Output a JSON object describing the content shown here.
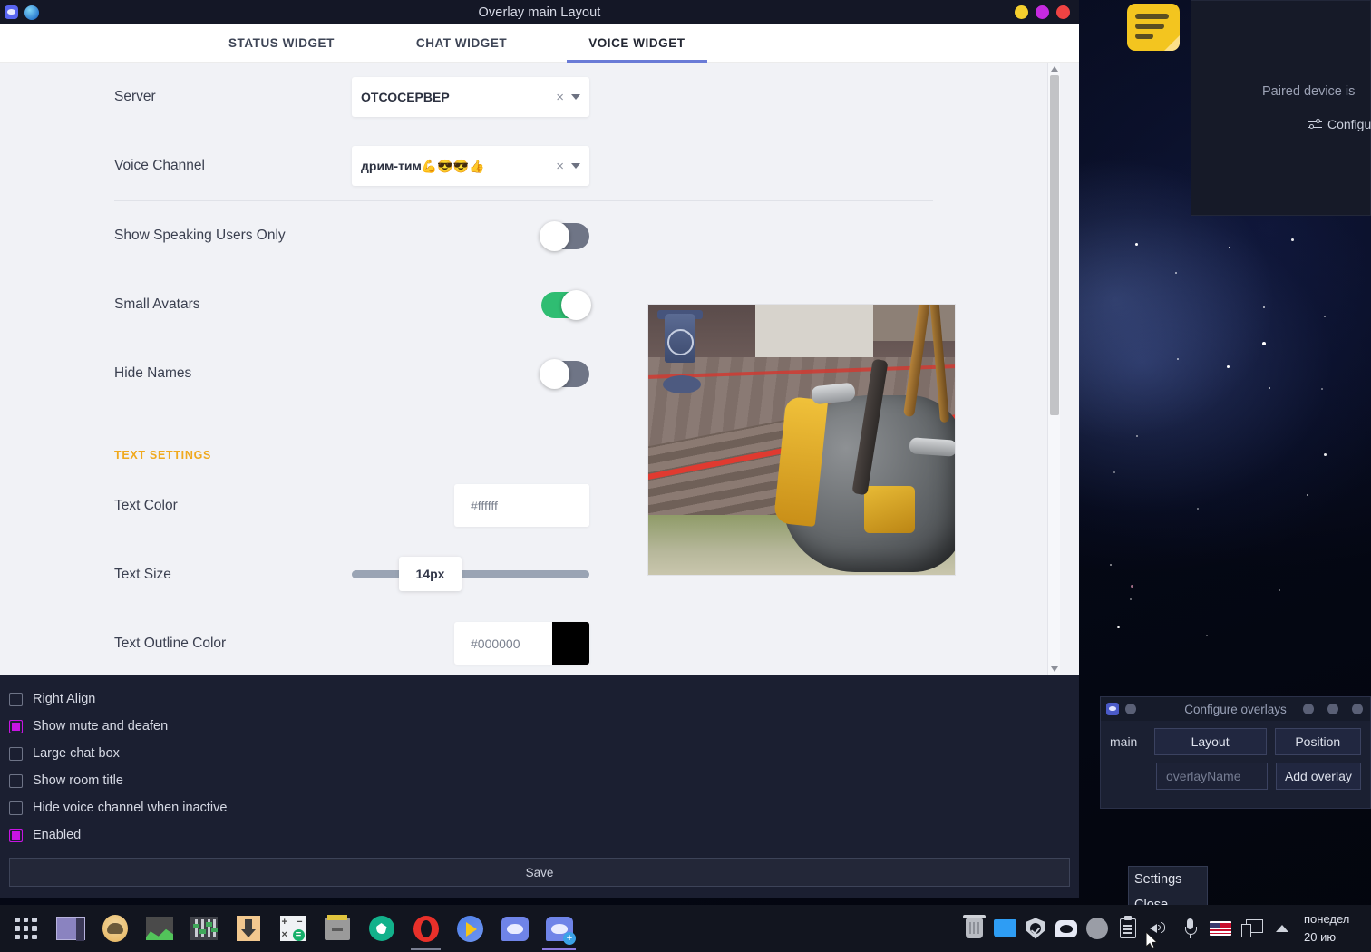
{
  "window": {
    "title": "Overlay main Layout",
    "titlebar_icons": [
      "discord-icon",
      "globe-icon"
    ],
    "controls": [
      "minimize-button",
      "maximize-button",
      "close-button"
    ],
    "control_colors": {
      "minimize": "#f5cf2e",
      "maximize": "#c62ae0",
      "close": "#ef4343"
    }
  },
  "tabs": [
    {
      "label": "STATUS WIDGET",
      "active": false
    },
    {
      "label": "CHAT WIDGET",
      "active": false
    },
    {
      "label": "VOICE WIDGET",
      "active": true
    }
  ],
  "accent": {
    "tab_underline": "#6a7bd6",
    "section_header": "#f0a91e",
    "toggle_on": "#2fbd72",
    "checkbox_on": "#c714e3"
  },
  "form": {
    "server": {
      "label": "Server",
      "value": "ОТСОСЕРВЕР",
      "clear_icon": "×",
      "caret_icon": "chevron-down-icon"
    },
    "voice_channel": {
      "label": "Voice Channel",
      "value": "дрим-тим💪😎😎👍",
      "clear_icon": "×",
      "caret_icon": "chevron-down-icon"
    },
    "toggles": [
      {
        "label": "Show Speaking Users Only",
        "on": false
      },
      {
        "label": "Small Avatars",
        "on": true
      },
      {
        "label": "Hide Names",
        "on": false
      }
    ],
    "text_settings_header": "TEXT SETTINGS",
    "text_color": {
      "label": "Text Color",
      "value": "#ffffff",
      "swatch": "#ffffff"
    },
    "text_size": {
      "label": "Text Size",
      "value": "14px"
    },
    "text_outline_color": {
      "label": "Text Outline Color",
      "value": "#000000",
      "swatch": "#000000"
    }
  },
  "checkboxes": [
    {
      "label": "Right Align",
      "checked": false
    },
    {
      "label": "Show mute and deafen",
      "checked": true
    },
    {
      "label": "Large chat box",
      "checked": false
    },
    {
      "label": "Show room title",
      "checked": false
    },
    {
      "label": "Hide voice channel when inactive",
      "checked": false
    },
    {
      "label": "Enabled",
      "checked": true
    }
  ],
  "save_button": "Save",
  "notification": {
    "message": "Paired device is",
    "configure_label": "Configure",
    "configure_icon": "sliders-icon"
  },
  "configure_overlays": {
    "title": "Configure overlays",
    "overlay_name_label": "main",
    "layout_button": "Layout",
    "position_button": "Position",
    "name_input_placeholder": "overlayName",
    "add_overlay_button": "Add overlay"
  },
  "context_menu": {
    "items": [
      "Settings",
      "Close"
    ]
  },
  "taskbar": {
    "launcher_icon": "app-grid-icon",
    "apps": [
      {
        "icon": "window-switcher-icon",
        "active": false
      },
      {
        "icon": "game-icon",
        "active": false
      },
      {
        "icon": "image-viewer-icon",
        "active": false
      },
      {
        "icon": "audio-mixer-icon",
        "active": false
      },
      {
        "icon": "downloads-icon",
        "active": false
      },
      {
        "icon": "calculator-icon",
        "active": false
      },
      {
        "icon": "archive-manager-icon",
        "active": false
      },
      {
        "icon": "screenshot-icon",
        "active": false
      },
      {
        "icon": "opera-browser-icon",
        "active": false
      },
      {
        "icon": "media-player-icon",
        "active": false
      },
      {
        "icon": "discord-icon",
        "active": false
      },
      {
        "icon": "discord-overlay-icon",
        "active": true
      }
    ],
    "tray": [
      "trash-icon",
      "folder-icon",
      "shield-icon",
      "discord-tray-icon",
      "grey-circle-icon",
      "clipboard-icon",
      "volume-icon",
      "microphone-icon",
      "us-flag-icon",
      "display-icon",
      "chevron-up-icon"
    ],
    "clock": {
      "weekday": "понедел",
      "date": "20 ию"
    }
  }
}
